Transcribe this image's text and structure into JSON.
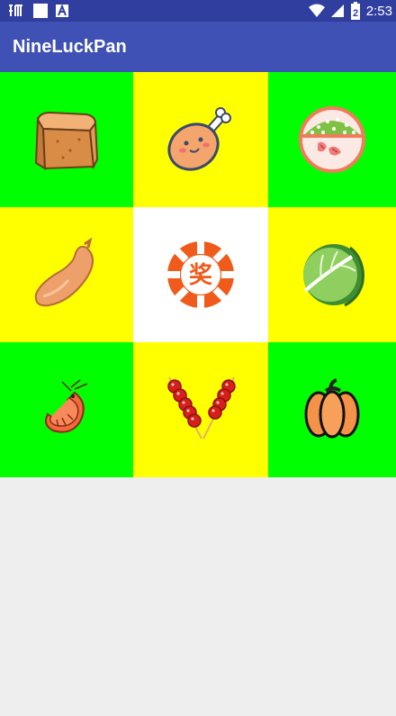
{
  "status_bar": {
    "time": "2:53",
    "battery_level": "2",
    "icons": [
      "carrier-icon",
      "square-notification-icon",
      "a-notification-icon",
      "wifi-icon",
      "signal-icon",
      "battery-icon"
    ]
  },
  "app_bar": {
    "title": "NineLuckPan",
    "color": "#3f51b5",
    "status_color": "#303f9f"
  },
  "grid": {
    "colors": {
      "green": "#00ff00",
      "yellow": "#ffff00",
      "center": "#ffffff"
    },
    "cells": [
      {
        "name": "tofu",
        "icon": "tofu-icon"
      },
      {
        "name": "chicken-drumstick",
        "icon": "drumstick-icon"
      },
      {
        "name": "rice-bowl",
        "icon": "rice-bowl-icon"
      },
      {
        "name": "sausage",
        "icon": "sausage-icon"
      },
      {
        "name": "prize-button",
        "icon": "prize-icon",
        "label": "奖"
      },
      {
        "name": "cabbage",
        "icon": "cabbage-icon"
      },
      {
        "name": "shrimp",
        "icon": "shrimp-icon"
      },
      {
        "name": "candied-haws",
        "icon": "skewer-icon"
      },
      {
        "name": "pumpkin",
        "icon": "pumpkin-icon"
      }
    ]
  }
}
